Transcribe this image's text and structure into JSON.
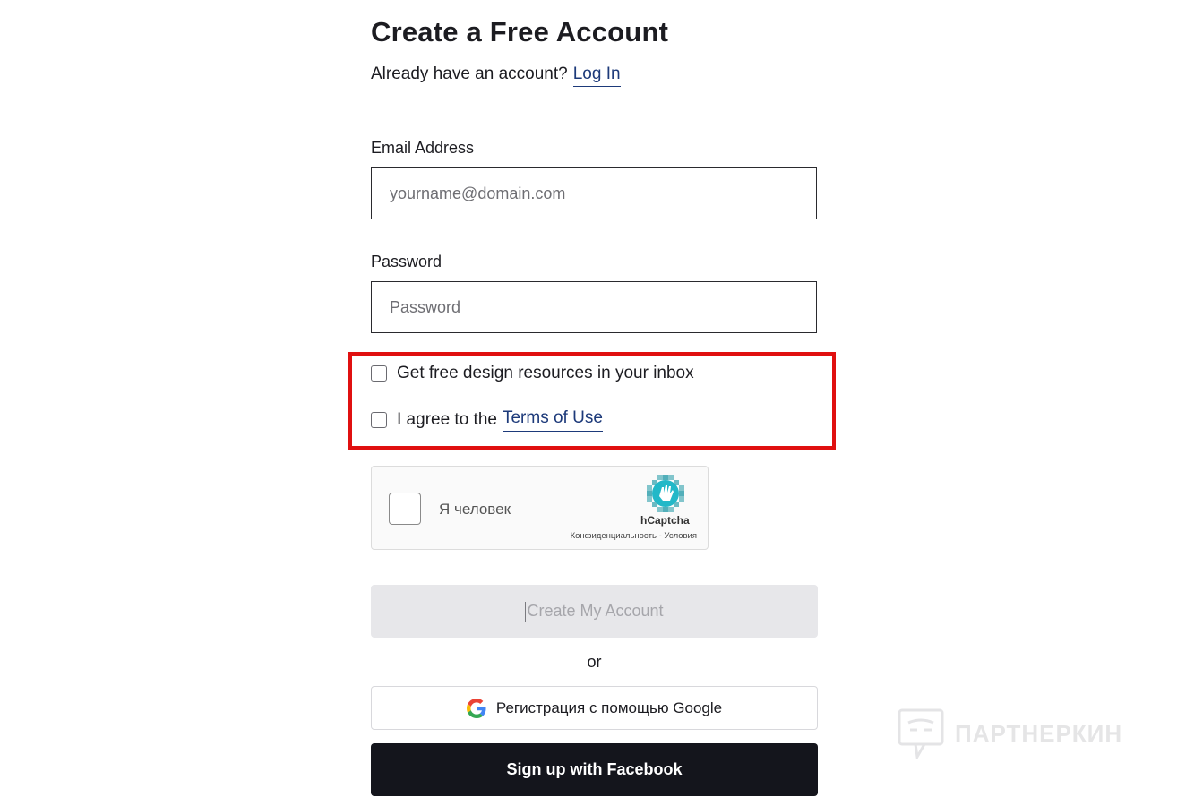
{
  "header": {
    "title": "Create a Free Account",
    "login_prompt": "Already have an account?",
    "login_link": "Log In"
  },
  "form": {
    "email": {
      "label": "Email Address",
      "placeholder": "yourname@domain.com",
      "value": ""
    },
    "password": {
      "label": "Password",
      "placeholder": "Password",
      "value": ""
    },
    "checkboxes": {
      "resources_label": "Get free design resources in your inbox",
      "resources_checked": false,
      "terms_prefix": "I agree to the",
      "terms_link": "Terms of Use",
      "terms_checked": false
    },
    "captcha": {
      "label": "Я человек",
      "brand": "hCaptcha",
      "links": "Конфиденциальность - Условия",
      "icon": "hcaptcha-logo-icon"
    },
    "create_button": "Create My Account",
    "or_text": "or",
    "google_button": "Регистрация с помощью Google",
    "facebook_button": "Sign up with Facebook"
  },
  "watermark": {
    "text": "ПАРТНЕРКИН",
    "icon": "partnerkin-logo-icon"
  },
  "colors": {
    "link": "#1d3a7a",
    "highlight": "#e01010",
    "facebook_bg": "#14151c",
    "disabled_bg": "#e7e7ea"
  }
}
